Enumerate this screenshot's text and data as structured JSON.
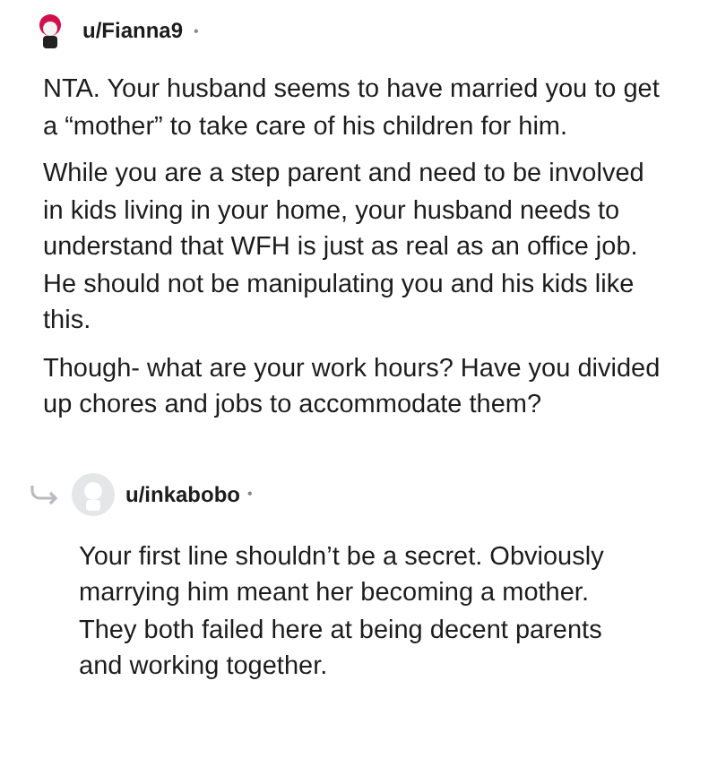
{
  "comments": [
    {
      "username": "u/Fianna9",
      "separator": "•",
      "paragraphs": [
        "NTA. Your husband seems to have married you to get a “mother” to take care of his children for him.",
        "While you are a step parent and need to be involved in kids living in your home, your husband needs to understand that WFH is just as real as an office job. He should not be manipulating you and his kids like this.",
        "Though- what are your work hours? Have you divided up chores and jobs to accommodate them?"
      ]
    }
  ],
  "reply": {
    "username": "u/inkabobo",
    "separator": "•",
    "paragraphs": [
      "Your first line shouldn’t be a secret. Obviously marrying him meant her becoming a mother. They both failed here at being decent parents and working together."
    ]
  }
}
